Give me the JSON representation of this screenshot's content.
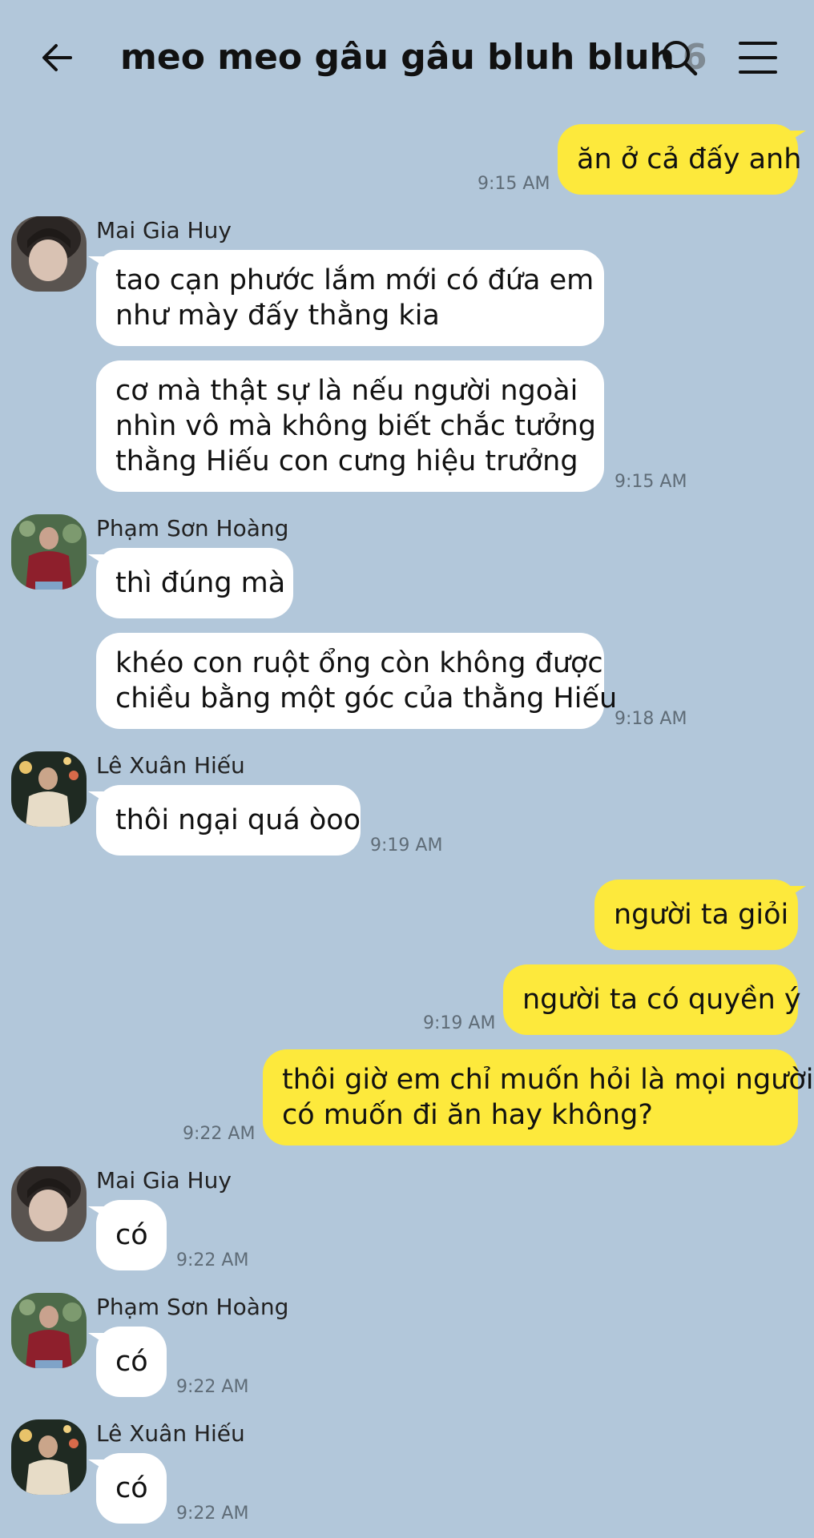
{
  "header": {
    "title": "meo meo gâu gâu bluh bluh",
    "member_count": "6",
    "back_icon": "arrow-left-icon",
    "search_icon": "search-icon",
    "menu_icon": "hamburger-menu-icon"
  },
  "colors": {
    "background": "#b2c7da",
    "incoming_bubble": "#ffffff",
    "outgoing_bubble": "#fde93c",
    "timestamp": "#5f6c77"
  },
  "messages": [
    {
      "direction": "out",
      "text": "ăn ở cả đấy anh",
      "time": "9:15 AM"
    },
    {
      "direction": "in",
      "sender": "Mai Gia Huy",
      "lines": [
        "tao cạn phước lắm mới có đứa em",
        "như mày đấy thằng kia"
      ]
    },
    {
      "direction": "in",
      "lines": [
        "cơ mà thật sự là nếu người ngoài",
        "nhìn vô mà không biết chắc tưởng",
        "thằng Hiếu con cưng hiệu trưởng"
      ],
      "time": "9:15 AM"
    },
    {
      "direction": "in",
      "sender": "Phạm Sơn Hoàng",
      "text": "thì đúng mà"
    },
    {
      "direction": "in",
      "lines": [
        "khéo con ruột ổng còn không được",
        "chiều bằng một góc của thằng Hiếu"
      ],
      "time": "9:18 AM"
    },
    {
      "direction": "in",
      "sender": "Lê Xuân Hiếu",
      "text": "thôi ngại quá òoo",
      "time": "9:19 AM"
    },
    {
      "direction": "out",
      "text": "người ta giỏi"
    },
    {
      "direction": "out",
      "text": "người ta có quyền ý",
      "time": "9:19 AM"
    },
    {
      "direction": "out",
      "lines": [
        "thôi giờ em chỉ muốn hỏi là mọi người",
        "có muốn đi ăn hay không?"
      ],
      "time": "9:22 AM"
    },
    {
      "direction": "in",
      "sender": "Mai Gia Huy",
      "text": "có",
      "time": "9:22 AM"
    },
    {
      "direction": "in",
      "sender": "Phạm Sơn Hoàng",
      "text": "có",
      "time": "9:22 AM"
    },
    {
      "direction": "in",
      "sender": "Lê Xuân Hiếu",
      "text": "có",
      "time": "9:22 AM"
    }
  ]
}
